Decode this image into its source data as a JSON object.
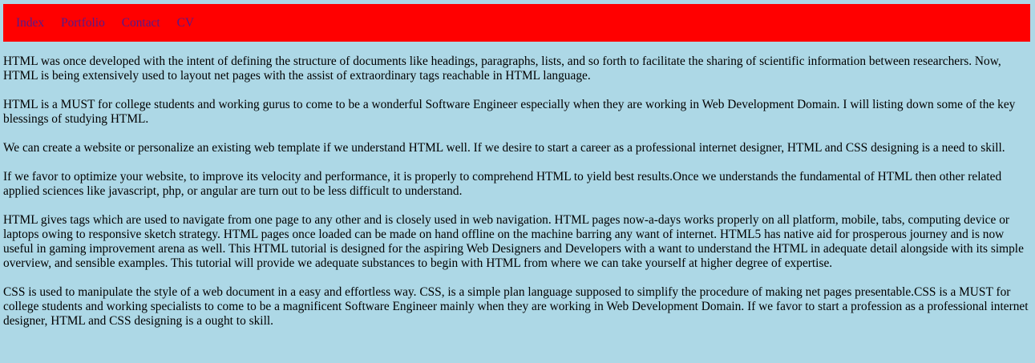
{
  "nav": {
    "items": [
      {
        "label": "Index"
      },
      {
        "label": "Portfolio"
      },
      {
        "label": "Contact"
      },
      {
        "label": "CV"
      }
    ]
  },
  "paragraphs": [
    "HTML was once developed with the intent of defining the structure of documents like headings, paragraphs, lists, and so forth to facilitate the sharing of scientific information between researchers. Now, HTML is being extensively used to layout net pages with the assist of extraordinary tags reachable in HTML language.",
    "HTML is a MUST for college students and working gurus to come to be a wonderful Software Engineer especially when they are working in Web Development Domain. I will listing down some of the key blessings of studying HTML.",
    "We can create a website or personalize an existing web template if we understand HTML well. If we desire to start a career as a professional internet designer, HTML and CSS designing is a need to skill.",
    "If we favor to optimize your website, to improve its velocity and performance, it is properly to comprehend HTML to yield best results.Once we understands the fundamental of HTML then other related applied sciences like javascript, php, or angular are turn out to be less difficult to understand.",
    "HTML gives tags which are used to navigate from one page to any other and is closely used in web navigation. HTML pages now-a-days works properly on all platform, mobile, tabs, computing device or laptops owing to responsive sketch strategy. HTML pages once loaded can be made on hand offline on the machine barring any want of internet. HTML5 has native aid for prosperous journey and is now useful in gaming improvement arena as well. This HTML tutorial is designed for the aspiring Web Designers and Developers with a want to understand the HTML in adequate detail alongside with its simple overview, and sensible examples. This tutorial will provide we adequate substances to begin with HTML from where we can take yourself at higher degree of expertise.",
    "CSS is used to manipulate the style of a web document in a easy and effortless way. CSS, is a simple plan language supposed to simplify the procedure of making net pages presentable.CSS is a MUST for college students and working specialists to come to be a magnificent Software Engineer mainly when they are working in Web Development Domain. If we favor to start a profession as a professional internet designer, HTML and CSS designing is a ought to skill."
  ],
  "colors": {
    "background": "#add8e6",
    "navbar": "#ff0000",
    "link": "#551a8b"
  }
}
